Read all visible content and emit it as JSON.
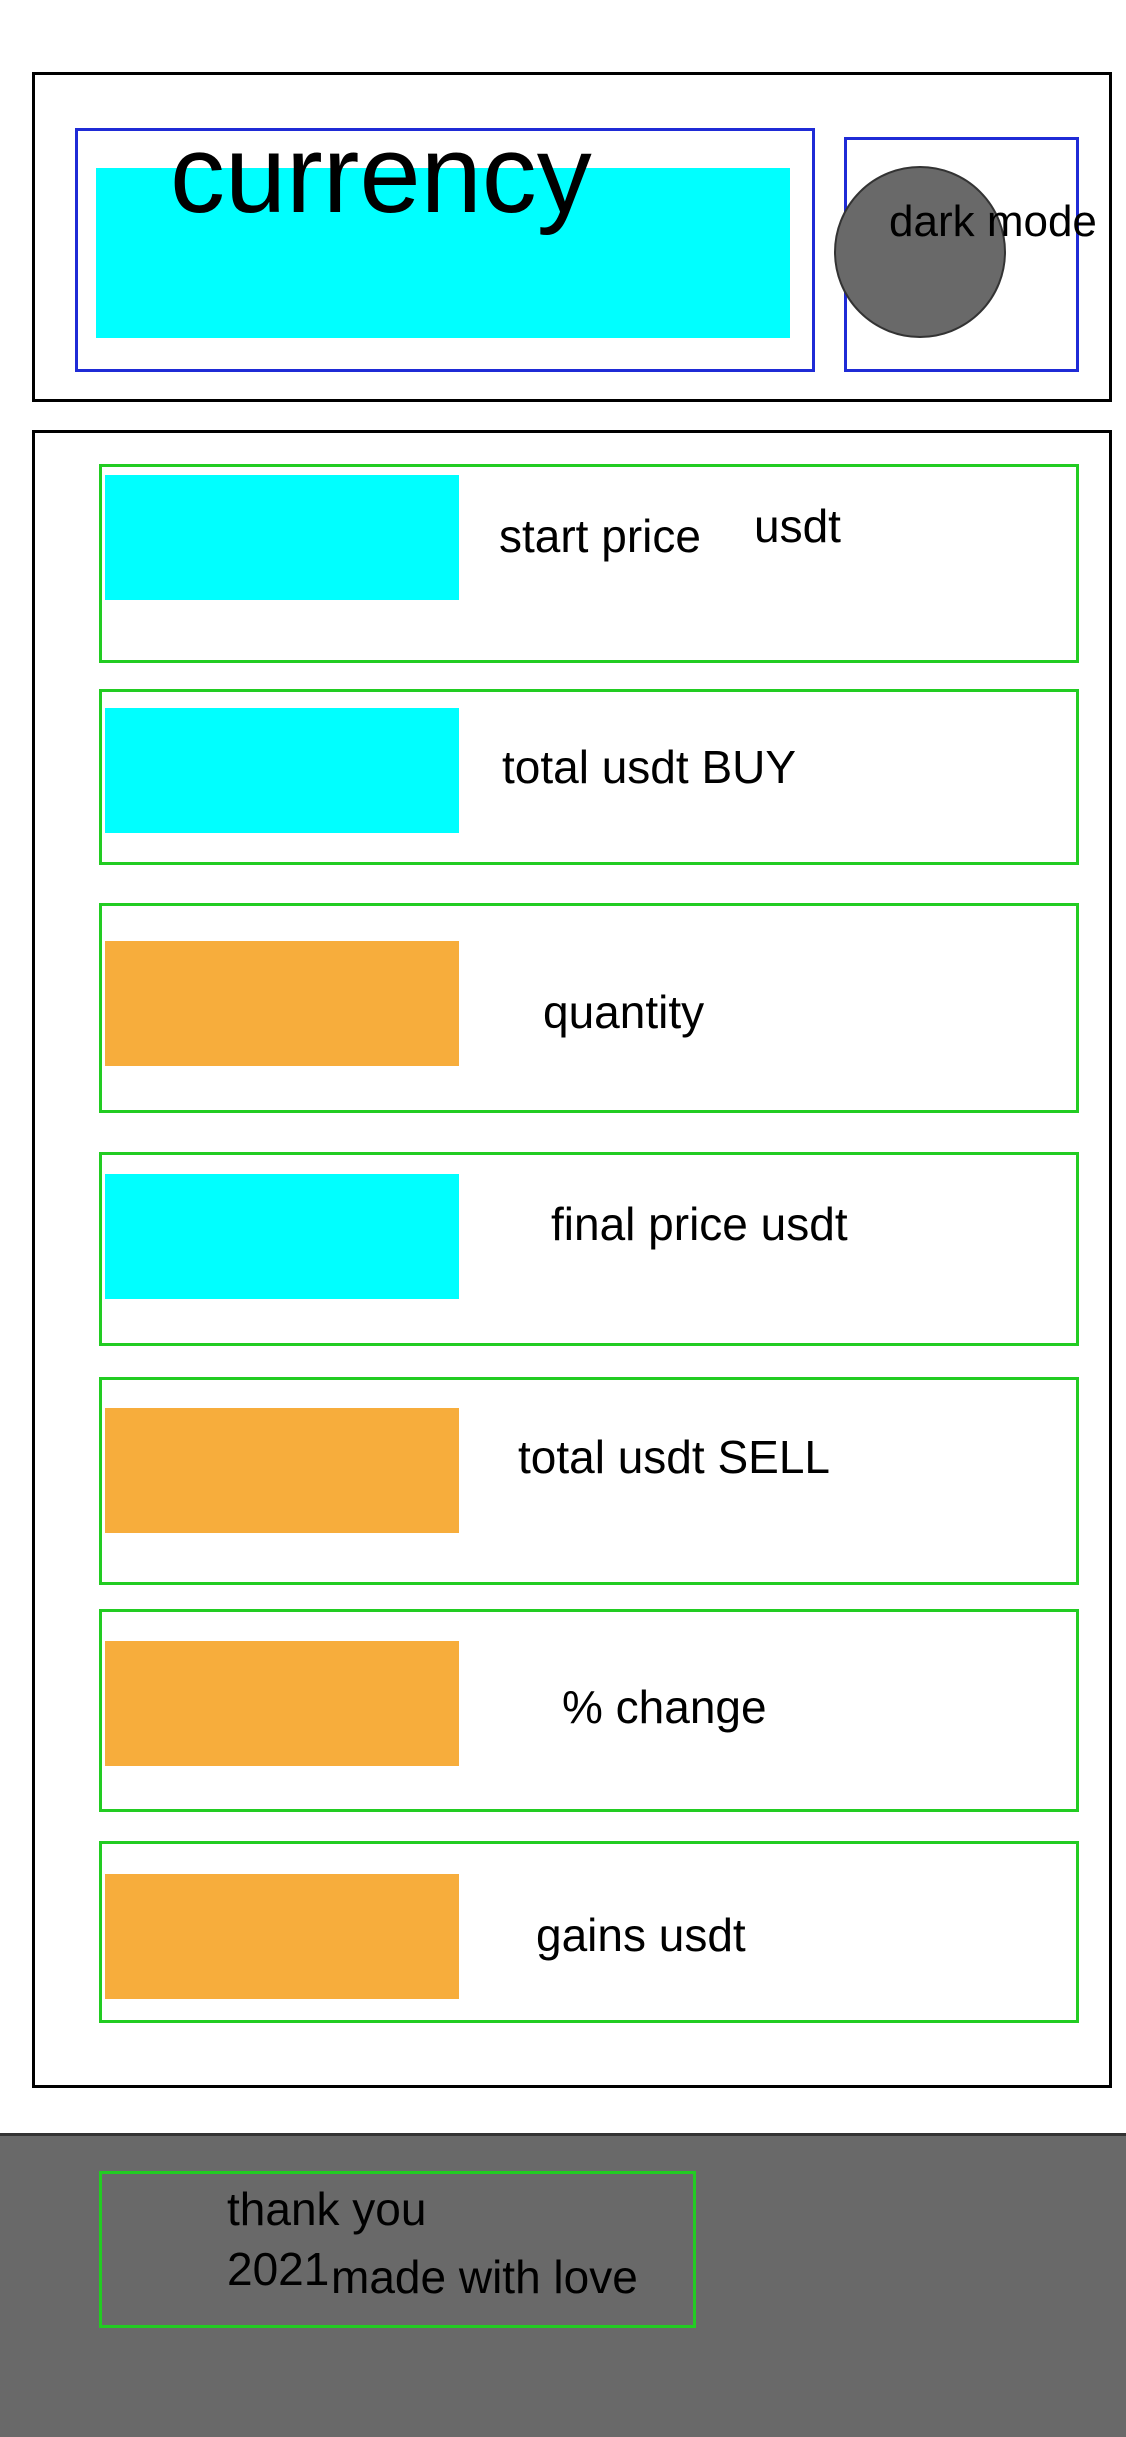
{
  "header": {
    "currency_label": "currency",
    "dark_mode_label": "dark mode"
  },
  "fields": [
    {
      "label": "start price",
      "fill": "cyan"
    },
    {
      "label": "total usdt BUY",
      "fill": "cyan"
    },
    {
      "label": "quantity",
      "fill": "orange"
    },
    {
      "label": "final price usdt",
      "fill": "cyan"
    },
    {
      "label": "total usdt SELL",
      "fill": "orange"
    },
    {
      "label": "% change",
      "fill": "orange"
    },
    {
      "label": "gains usdt",
      "fill": "orange"
    }
  ],
  "start_price_unit": "usdt",
  "footer": {
    "thanks": "thank you",
    "year": "2021",
    "tagline": "made with love"
  },
  "colors": {
    "cyan": "#00ffff",
    "orange": "#f7ad3c",
    "dark_gray": "#696969",
    "blue_border": "#1f2bd6",
    "green_border": "#22cc22"
  }
}
